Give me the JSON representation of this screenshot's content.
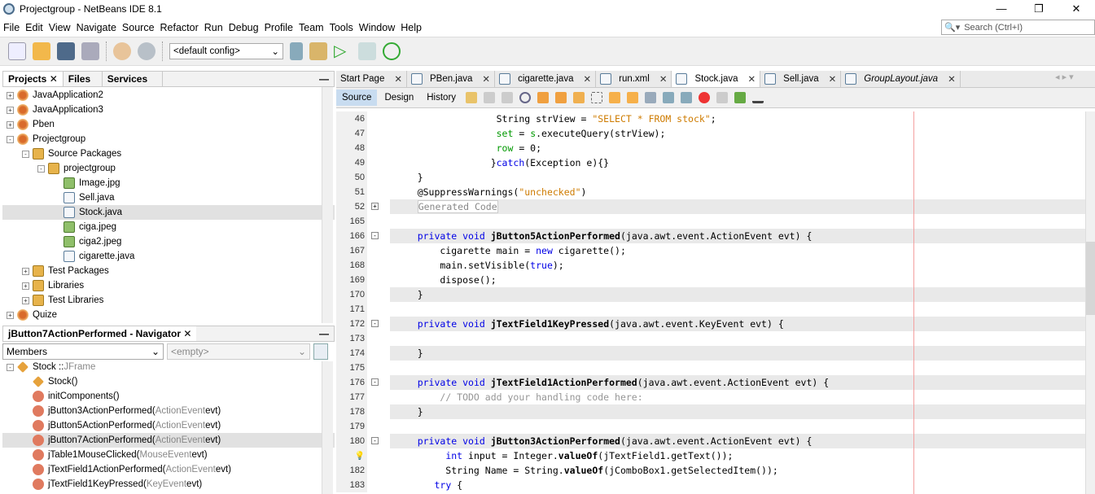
{
  "window": {
    "title": "Projectgroup - NetBeans IDE 8.1",
    "controls": [
      "—",
      "❐",
      "✕"
    ]
  },
  "menu": [
    "File",
    "Edit",
    "View",
    "Navigate",
    "Source",
    "Refactor",
    "Run",
    "Debug",
    "Profile",
    "Team",
    "Tools",
    "Window",
    "Help"
  ],
  "search": {
    "placeholder": "Search (Ctrl+I)"
  },
  "toolbar": {
    "config": "<default config>"
  },
  "projects_panel": {
    "tabs": [
      "Projects",
      "Files",
      "Services"
    ],
    "tree": [
      {
        "label": "JavaApplication2",
        "depth": 0,
        "icon": "proj",
        "pm": "+"
      },
      {
        "label": "JavaApplication3",
        "depth": 0,
        "icon": "proj",
        "pm": "+"
      },
      {
        "label": "Pben",
        "depth": 0,
        "icon": "proj",
        "pm": "+"
      },
      {
        "label": "Projectgroup",
        "depth": 0,
        "icon": "proj",
        "pm": "-"
      },
      {
        "label": "Source Packages",
        "depth": 1,
        "icon": "pkg",
        "pm": "-"
      },
      {
        "label": "projectgroup",
        "depth": 2,
        "icon": "pkg",
        "pm": "-"
      },
      {
        "label": "Image.jpg",
        "depth": 3,
        "icon": "img"
      },
      {
        "label": "Sell.java",
        "depth": 3,
        "icon": "file"
      },
      {
        "label": "Stock.java",
        "depth": 3,
        "icon": "file",
        "selected": true
      },
      {
        "label": "ciga.jpeg",
        "depth": 3,
        "icon": "img"
      },
      {
        "label": "ciga2.jpeg",
        "depth": 3,
        "icon": "img"
      },
      {
        "label": "cigarette.java",
        "depth": 3,
        "icon": "file"
      },
      {
        "label": "Test Packages",
        "depth": 1,
        "icon": "pkg",
        "pm": "+"
      },
      {
        "label": "Libraries",
        "depth": 1,
        "icon": "pkg",
        "pm": "+"
      },
      {
        "label": "Test Libraries",
        "depth": 1,
        "icon": "pkg",
        "pm": "+"
      },
      {
        "label": "Quize",
        "depth": 0,
        "icon": "proj",
        "pm": "+"
      }
    ]
  },
  "navigator": {
    "title": "jButton7ActionPerformed - Navigator",
    "members": "Members",
    "filter": "<empty>",
    "items": [
      {
        "name": "Stock :: ",
        "type": "JFrame",
        "depth": 0,
        "icon": "ctor",
        "pm": "-"
      },
      {
        "name": "Stock()",
        "type": "",
        "depth": 1,
        "icon": "ctor"
      },
      {
        "name": "initComponents()",
        "type": "",
        "depth": 1,
        "icon": "meth"
      },
      {
        "name": "jButton3ActionPerformed(",
        "type": "ActionEvent",
        "suffix": " evt)",
        "depth": 1,
        "icon": "meth"
      },
      {
        "name": "jButton5ActionPerformed(",
        "type": "ActionEvent",
        "suffix": " evt)",
        "depth": 1,
        "icon": "meth"
      },
      {
        "name": "jButton7ActionPerformed(",
        "type": "ActionEvent",
        "suffix": " evt)",
        "depth": 1,
        "icon": "meth",
        "selected": true
      },
      {
        "name": "jTable1MouseClicked(",
        "type": "MouseEvent",
        "suffix": " evt)",
        "depth": 1,
        "icon": "meth"
      },
      {
        "name": "jTextField1ActionPerformed(",
        "type": "ActionEvent",
        "suffix": " evt)",
        "depth": 1,
        "icon": "meth"
      },
      {
        "name": "jTextField1KeyPressed(",
        "type": "KeyEvent",
        "suffix": " evt)",
        "depth": 1,
        "icon": "meth"
      }
    ]
  },
  "editor": {
    "tabs": [
      {
        "label": "Start Page"
      },
      {
        "label": "PBen.java"
      },
      {
        "label": "cigarette.java"
      },
      {
        "label": "run.xml"
      },
      {
        "label": "Stock.java",
        "active": true
      },
      {
        "label": "Sell.java"
      },
      {
        "label": "GroupLayout.java",
        "italic": true
      }
    ],
    "modes": [
      "Source",
      "Design",
      "History"
    ],
    "lines": [
      {
        "n": "46",
        "hl": false,
        "t": [
          [
            "                  String strView = ",
            ""
          ],
          [
            "\"SELECT * FROM stock\"",
            "st"
          ],
          [
            ";",
            ""
          ]
        ]
      },
      {
        "n": "47",
        "hl": false,
        "t": [
          [
            "                  ",
            ""
          ],
          [
            "set",
            "fd"
          ],
          [
            " = ",
            ""
          ],
          [
            "s",
            "fd"
          ],
          [
            ".executeQuery(strView);",
            ""
          ]
        ]
      },
      {
        "n": "48",
        "hl": false,
        "t": [
          [
            "                  ",
            ""
          ],
          [
            "row",
            "fd"
          ],
          [
            " = 0;",
            ""
          ]
        ]
      },
      {
        "n": "49",
        "hl": false,
        "t": [
          [
            "                 }",
            ""
          ],
          [
            "catch",
            "kw"
          ],
          [
            "(Exception e){}",
            ""
          ]
        ]
      },
      {
        "n": "50",
        "hl": false,
        "t": [
          [
            "    }",
            ""
          ]
        ]
      },
      {
        "n": "51",
        "hl": false,
        "t": [
          [
            "    @SuppressWarnings(",
            ""
          ],
          [
            "\"unchecked\"",
            "st"
          ],
          [
            ")",
            ""
          ]
        ]
      },
      {
        "n": "52",
        "hl": true,
        "fold": "+",
        "t": [
          [
            "    ",
            ""
          ],
          [
            "Generated Code",
            "gc"
          ]
        ]
      },
      {
        "n": "165",
        "hl": false,
        "t": [
          [
            "",
            ""
          ]
        ]
      },
      {
        "n": "166",
        "hl": true,
        "fold": "-",
        "t": [
          [
            "    ",
            ""
          ],
          [
            "private void ",
            "kw"
          ],
          [
            "jButton5ActionPerformed",
            "bd"
          ],
          [
            "(java.awt.event.ActionEvent evt) {",
            ""
          ]
        ]
      },
      {
        "n": "167",
        "hl": false,
        "t": [
          [
            "        cigarette main = ",
            ""
          ],
          [
            "new",
            "kw"
          ],
          [
            " cigarette();",
            ""
          ]
        ]
      },
      {
        "n": "168",
        "hl": false,
        "t": [
          [
            "        main.setVisible(",
            ""
          ],
          [
            "true",
            "kw"
          ],
          [
            ");",
            ""
          ]
        ]
      },
      {
        "n": "169",
        "hl": false,
        "t": [
          [
            "        dispose();",
            ""
          ]
        ]
      },
      {
        "n": "170",
        "hl": true,
        "t": [
          [
            "    }",
            ""
          ]
        ]
      },
      {
        "n": "171",
        "hl": false,
        "t": [
          [
            "",
            ""
          ]
        ]
      },
      {
        "n": "172",
        "hl": true,
        "fold": "-",
        "t": [
          [
            "    ",
            ""
          ],
          [
            "private void ",
            "kw"
          ],
          [
            "jTextField1KeyPressed",
            "bd"
          ],
          [
            "(java.awt.event.KeyEvent evt) {",
            ""
          ]
        ]
      },
      {
        "n": "173",
        "hl": false,
        "t": [
          [
            "",
            ""
          ]
        ]
      },
      {
        "n": "174",
        "hl": true,
        "t": [
          [
            "    }",
            ""
          ]
        ]
      },
      {
        "n": "175",
        "hl": false,
        "t": [
          [
            "",
            ""
          ]
        ]
      },
      {
        "n": "176",
        "hl": true,
        "fold": "-",
        "t": [
          [
            "    ",
            ""
          ],
          [
            "private void ",
            "kw"
          ],
          [
            "jTextField1ActionPerformed",
            "bd"
          ],
          [
            "(java.awt.event.ActionEvent evt) {",
            ""
          ]
        ]
      },
      {
        "n": "177",
        "hl": false,
        "t": [
          [
            "        ",
            ""
          ],
          [
            "// TODO add your handling code here:",
            "cm"
          ]
        ]
      },
      {
        "n": "178",
        "hl": true,
        "t": [
          [
            "    }",
            ""
          ]
        ]
      },
      {
        "n": "179",
        "hl": false,
        "t": [
          [
            "",
            ""
          ]
        ]
      },
      {
        "n": "180",
        "hl": true,
        "fold": "-",
        "t": [
          [
            "    ",
            ""
          ],
          [
            "private void ",
            "kw"
          ],
          [
            "jButton3ActionPerformed",
            "bd"
          ],
          [
            "(java.awt.event.ActionEvent evt) {",
            ""
          ]
        ]
      },
      {
        "n": "",
        "hl": false,
        "bulb": true,
        "t": [
          [
            "         ",
            ""
          ],
          [
            "int",
            "kw"
          ],
          [
            " input = Integer.",
            ""
          ],
          [
            "valueOf",
            "bd"
          ],
          [
            "(jTextField1.getText());",
            ""
          ]
        ]
      },
      {
        "n": "182",
        "hl": false,
        "t": [
          [
            "         String Name = String.",
            ""
          ],
          [
            "valueOf",
            "bd"
          ],
          [
            "(jComboBox1.getSelectedItem());",
            ""
          ]
        ]
      },
      {
        "n": "183",
        "hl": false,
        "t": [
          [
            "       ",
            ""
          ],
          [
            "try",
            "kw"
          ],
          [
            " {",
            ""
          ]
        ]
      }
    ]
  },
  "colors": {
    "keyword": "#0000e6",
    "string": "#ce7b00",
    "field": "#009900",
    "comment": "#969696",
    "margin": "#f4a0a0"
  }
}
